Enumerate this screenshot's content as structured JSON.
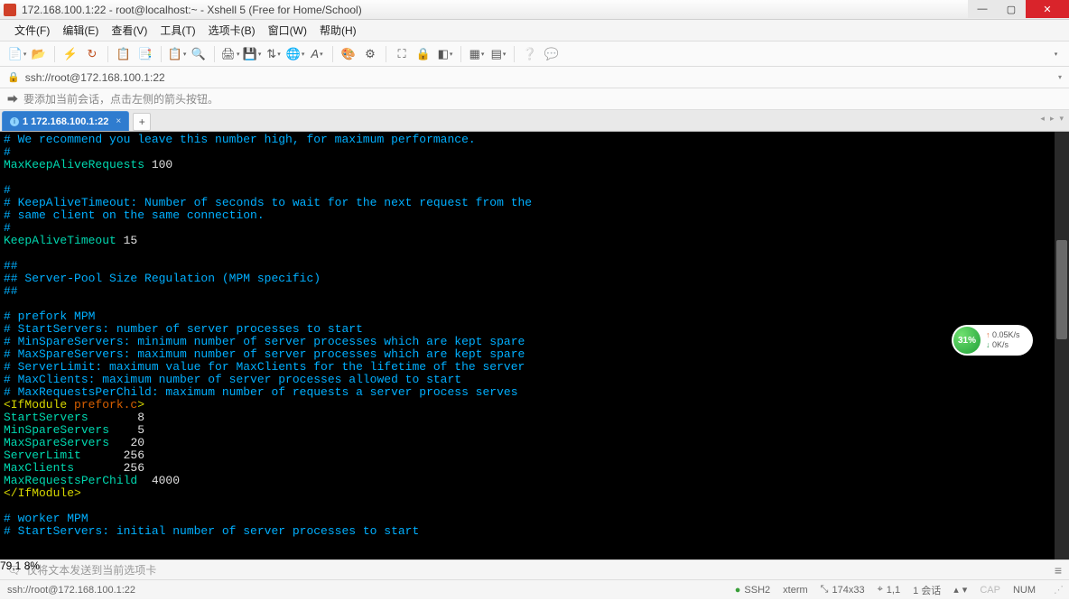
{
  "titlebar": {
    "text": "172.168.100.1:22 - root@localhost:~ - Xshell 5 (Free for Home/School)"
  },
  "menu": {
    "file": "文件(F)",
    "edit": "编辑(E)",
    "view": "查看(V)",
    "tools": "工具(T)",
    "tabs": "选项卡(B)",
    "window": "窗口(W)",
    "help": "帮助(H)"
  },
  "address": {
    "url": "ssh://root@172.168.100.1:22"
  },
  "hint": {
    "text": "要添加当前会话，点击左侧的箭头按钮。"
  },
  "tab": {
    "label": "1 172.168.100.1:22"
  },
  "terminal": {
    "lines": [
      {
        "c": "comment",
        "t": "# We recommend you leave this number high, for maximum performance."
      },
      {
        "c": "comment",
        "t": "#"
      },
      {
        "c": "kv",
        "k": "MaxKeepAliveRequests",
        "v": " 100"
      },
      {
        "c": "blank",
        "t": ""
      },
      {
        "c": "comment",
        "t": "#"
      },
      {
        "c": "comment",
        "t": "# KeepAliveTimeout: Number of seconds to wait for the next request from the"
      },
      {
        "c": "comment",
        "t": "# same client on the same connection."
      },
      {
        "c": "comment",
        "t": "#"
      },
      {
        "c": "kv",
        "k": "KeepAliveTimeout",
        "v": " 15"
      },
      {
        "c": "blank",
        "t": ""
      },
      {
        "c": "comment",
        "t": "##"
      },
      {
        "c": "comment",
        "t": "## Server-Pool Size Regulation (MPM specific)"
      },
      {
        "c": "comment",
        "t": "##"
      },
      {
        "c": "blank",
        "t": ""
      },
      {
        "c": "comment",
        "t": "# prefork MPM"
      },
      {
        "c": "comment",
        "t": "# StartServers: number of server processes to start"
      },
      {
        "c": "comment",
        "t": "# MinSpareServers: minimum number of server processes which are kept spare"
      },
      {
        "c": "comment",
        "t": "# MaxSpareServers: maximum number of server processes which are kept spare"
      },
      {
        "c": "comment",
        "t": "# ServerLimit: maximum value for MaxClients for the lifetime of the server"
      },
      {
        "c": "comment",
        "t": "# MaxClients: maximum number of server processes allowed to start"
      },
      {
        "c": "comment",
        "t": "# MaxRequestsPerChild: maximum number of requests a server process serves"
      },
      {
        "c": "tagopen",
        "t": "<IfModule ",
        "m": "prefork.c",
        "e": ">"
      },
      {
        "c": "kv",
        "k": "StartServers       ",
        "v": "8"
      },
      {
        "c": "kv",
        "k": "MinSpareServers    ",
        "v": "5"
      },
      {
        "c": "kv",
        "k": "MaxSpareServers   ",
        "v": "20"
      },
      {
        "c": "kv",
        "k": "ServerLimit      ",
        "v": "256"
      },
      {
        "c": "kv",
        "k": "MaxClients       ",
        "v": "256"
      },
      {
        "c": "kv",
        "k": "MaxRequestsPerChild  ",
        "v": "4000"
      },
      {
        "c": "tagclose",
        "t": "</IfModule>"
      },
      {
        "c": "blank",
        "t": ""
      },
      {
        "c": "comment",
        "t": "# worker MPM"
      },
      {
        "c": "comment",
        "t": "# StartServers: initial number of server processes to start"
      }
    ],
    "pos": "79,1",
    "pct": "8%"
  },
  "netwidget": {
    "pct": "31%",
    "up": "0.05K/s",
    "dn": "0K/s"
  },
  "bottominput": {
    "placeholder": "仅将文本发送到当前选项卡"
  },
  "status": {
    "conn": "ssh://root@172.168.100.1:22",
    "ssh": "SSH2",
    "term": "xterm",
    "size": "174x33",
    "rc": "1,1",
    "sess": "1 会话",
    "cap": "CAP",
    "num": "NUM"
  }
}
